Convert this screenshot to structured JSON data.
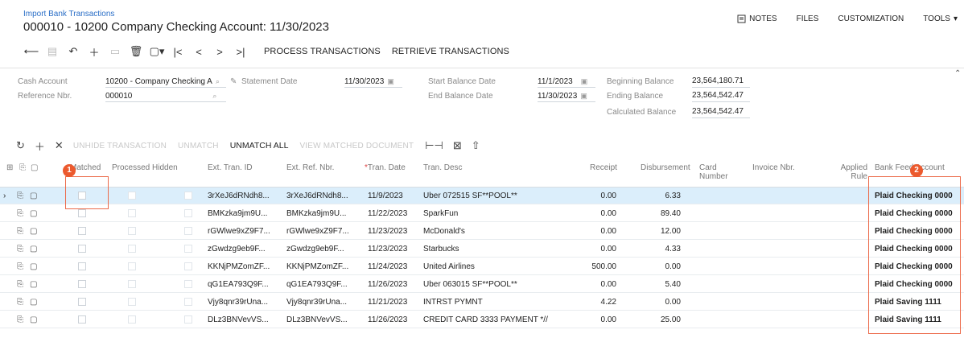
{
  "header": {
    "breadcrumb": "Import Bank Transactions",
    "title": "000010 - 10200 Company Checking Account: 11/30/2023",
    "actions": [
      "NOTES",
      "FILES",
      "CUSTOMIZATION",
      "TOOLS"
    ]
  },
  "toolbar": {
    "process": "PROCESS TRANSACTIONS",
    "retrieve": "RETRIEVE TRANSACTIONS"
  },
  "form": {
    "cash_account_label": "Cash Account",
    "cash_account_value": "10200 - Company Checking A",
    "reference_label": "Reference Nbr.",
    "reference_value": "000010",
    "statement_date_label": "Statement Date",
    "statement_date_value": "11/30/2023",
    "start_balance_date_label": "Start Balance Date",
    "start_balance_date_value": "11/1/2023",
    "end_balance_date_label": "End Balance Date",
    "end_balance_date_value": "11/30/2023",
    "beginning_balance_label": "Beginning Balance",
    "beginning_balance_value": "23,564,180.71",
    "ending_balance_label": "Ending Balance",
    "ending_balance_value": "23,564,542.47",
    "calculated_balance_label": "Calculated Balance",
    "calculated_balance_value": "23,564,542.47"
  },
  "grid_toolbar": {
    "unhide": "UNHIDE TRANSACTION",
    "unmatch": "UNMATCH",
    "unmatch_all": "UNMATCH ALL",
    "view_matched": "VIEW MATCHED DOCUMENT"
  },
  "badges": [
    "1",
    "2"
  ],
  "columns": {
    "matched": "Matched",
    "processed": "Processed",
    "hidden": "Hidden",
    "ext_tran_id": "Ext. Tran. ID",
    "ext_ref_nbr": "Ext. Ref. Nbr.",
    "tran_date": "Tran. Date",
    "tran_desc": "Tran. Desc",
    "receipt": "Receipt",
    "disbursement": "Disbursement",
    "card_number": "Card Number",
    "invoice_nbr": "Invoice Nbr.",
    "applied_rule": "Applied Rule",
    "bank_feed_account": "Bank Feed Account"
  },
  "rows": [
    {
      "ext_tran_id": "3rXeJ6dRNdh8...",
      "ext_ref_nbr": "3rXeJ6dRNdh8...",
      "tran_date": "11/9/2023",
      "tran_desc": "Uber 072515 SF**POOL**",
      "receipt": "0.00",
      "disbursement": "6.33",
      "bank_feed_account": "Plaid Checking 0000"
    },
    {
      "ext_tran_id": "BMKzka9jm9U...",
      "ext_ref_nbr": "BMKzka9jm9U...",
      "tran_date": "11/22/2023",
      "tran_desc": "SparkFun",
      "receipt": "0.00",
      "disbursement": "89.40",
      "bank_feed_account": "Plaid Checking 0000"
    },
    {
      "ext_tran_id": "rGWlwe9xZ9F7...",
      "ext_ref_nbr": "rGWlwe9xZ9F7...",
      "tran_date": "11/23/2023",
      "tran_desc": "McDonald's",
      "receipt": "0.00",
      "disbursement": "12.00",
      "bank_feed_account": "Plaid Checking 0000"
    },
    {
      "ext_tran_id": "zGwdzg9eb9F...",
      "ext_ref_nbr": "zGwdzg9eb9F...",
      "tran_date": "11/23/2023",
      "tran_desc": "Starbucks",
      "receipt": "0.00",
      "disbursement": "4.33",
      "bank_feed_account": "Plaid Checking 0000"
    },
    {
      "ext_tran_id": "KKNjPMZomZF...",
      "ext_ref_nbr": "KKNjPMZomZF...",
      "tran_date": "11/24/2023",
      "tran_desc": "United Airlines",
      "receipt": "500.00",
      "disbursement": "0.00",
      "bank_feed_account": "Plaid Checking 0000"
    },
    {
      "ext_tran_id": "qG1EA793Q9F...",
      "ext_ref_nbr": "qG1EA793Q9F...",
      "tran_date": "11/26/2023",
      "tran_desc": "Uber 063015 SF**POOL**",
      "receipt": "0.00",
      "disbursement": "5.40",
      "bank_feed_account": "Plaid Checking 0000"
    },
    {
      "ext_tran_id": "Vjy8qnr39rUna...",
      "ext_ref_nbr": "Vjy8qnr39rUna...",
      "tran_date": "11/21/2023",
      "tran_desc": "INTRST PYMNT",
      "receipt": "4.22",
      "disbursement": "0.00",
      "bank_feed_account": "Plaid Saving 1111"
    },
    {
      "ext_tran_id": "DLz3BNVevVS...",
      "ext_ref_nbr": "DLz3BNVevVS...",
      "tran_date": "11/26/2023",
      "tran_desc": "CREDIT CARD 3333 PAYMENT *//",
      "receipt": "0.00",
      "disbursement": "25.00",
      "bank_feed_account": "Plaid Saving 1111"
    }
  ]
}
